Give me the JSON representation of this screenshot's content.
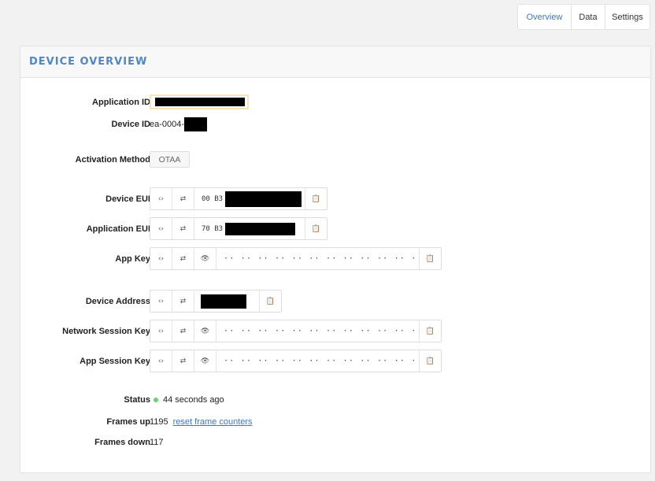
{
  "tabs": [
    {
      "label": "Overview",
      "active": true
    },
    {
      "label": "Data",
      "active": false
    },
    {
      "label": "Settings",
      "active": false
    }
  ],
  "card": {
    "title": "DEVICE OVERVIEW"
  },
  "fields": {
    "application_id": {
      "label": "Application ID"
    },
    "device_id": {
      "label": "Device ID",
      "value_prefix": "ea-0004-"
    },
    "activation_method": {
      "label": "Activation Method",
      "value": "OTAA"
    },
    "device_eui": {
      "label": "Device EUI",
      "value_prefix": "00 B3"
    },
    "application_eui": {
      "label": "Application EUI",
      "value_prefix": "70 B3"
    },
    "app_key": {
      "label": "App Key",
      "value": "·· ·· ·· ·· ·· ·· ·· ·· ·· ·· ·· ·· ·· ·· ·· ··"
    },
    "device_address": {
      "label": "Device Address"
    },
    "network_session_key": {
      "label": "Network Session Key",
      "value": "·· ·· ·· ·· ·· ·· ·· ·· ·· ·· ·· ·· ·· ·· ·· ··"
    },
    "app_session_key": {
      "label": "App Session Key",
      "value": "·· ·· ·· ·· ·· ·· ·· ·· ·· ·· ·· ·· ·· ·· ·· ··"
    }
  },
  "status": {
    "label": "Status",
    "value": "44 seconds ago",
    "color": "#66d36e"
  },
  "frames_up": {
    "label": "Frames up",
    "value": "1195",
    "reset_link": "reset frame counters"
  },
  "frames_down": {
    "label": "Frames down",
    "value": "117"
  },
  "icons": {
    "format": "‹›",
    "swap": "⇄",
    "eye": "👁",
    "copy": "📋"
  },
  "colors": {
    "accent": "#3b78c4",
    "header_text": "#4f86c6"
  }
}
